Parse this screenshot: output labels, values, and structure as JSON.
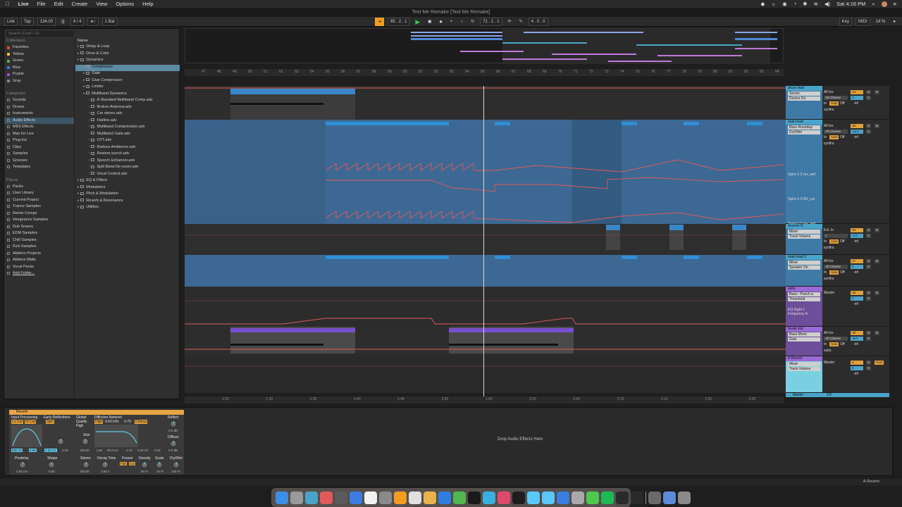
{
  "menubar": {
    "items": [
      "Live",
      "File",
      "Edit",
      "Create",
      "View",
      "Options",
      "Help"
    ],
    "clock": "Sat 4:16 PM"
  },
  "window": {
    "title": "Text Me Remake  [Text Me Remake]"
  },
  "control_bar": {
    "link": "Link",
    "tap": "Tap",
    "tempo": "134.00",
    "signature": "4 / 4",
    "metronome": "●○",
    "quantize": "1 Bar",
    "position": "65 .  2 .  1",
    "loop_start": "71 .  1 .  1",
    "loop_length": "4 .  0 .  0",
    "key": "Key",
    "midi": "MIDI",
    "cpu": "14 %"
  },
  "browser": {
    "search_placeholder": "Search (Cmd + F)",
    "collections_title": "Collections",
    "collections": [
      {
        "label": "Favorites",
        "color": "#e0463a"
      },
      {
        "label": "Yellow",
        "color": "#e9c43a"
      },
      {
        "label": "Green",
        "color": "#4fb84f"
      },
      {
        "label": "Blue",
        "color": "#3a7de0"
      },
      {
        "label": "Purple",
        "color": "#9a4fd8"
      },
      {
        "label": "Gray",
        "color": "#8a8a8a"
      }
    ],
    "categories_title": "Categories",
    "categories": [
      "Sounds",
      "Drums",
      "Instruments",
      "Audio Effects",
      "MIDI Effects",
      "Max for Live",
      "Plug-Ins",
      "Clips",
      "Samples",
      "Grooves",
      "Templates"
    ],
    "selected_category": "Audio Effects",
    "places_title": "Places",
    "places": [
      "Packs",
      "User Library",
      "Current Project",
      "Trance Samples",
      "Remix Comps",
      "Vengeance Samples",
      "Dub Snares",
      "EDM Samples",
      "Chill Samples",
      "Kick Samples",
      "Ableton Projects",
      "Ableton Midis",
      "Vocal Packs",
      "Add Folder..."
    ],
    "name_header": "Name",
    "items": [
      {
        "label": "Delay & Loop",
        "indent": 0
      },
      {
        "label": "Drive & Color",
        "indent": 0
      },
      {
        "label": "Dynamics",
        "indent": 0
      },
      {
        "label": "Compressor",
        "indent": 1,
        "selected": true
      },
      {
        "label": "Gate",
        "indent": 1
      },
      {
        "label": "Glue Compressor",
        "indent": 1
      },
      {
        "label": "Limiter",
        "indent": 1
      },
      {
        "label": "Multiband Dynamics",
        "indent": 1
      },
      {
        "label": "A Standard Multiband Comp.adv",
        "indent": 2
      },
      {
        "label": "Broken Antenna.adv",
        "indent": 2
      },
      {
        "label": "Car stereo.adv",
        "indent": 2
      },
      {
        "label": "Flatline.adv",
        "indent": 2
      },
      {
        "label": "Multiband Compression.adv",
        "indent": 2
      },
      {
        "label": "Multiband Gate.adv",
        "indent": 2
      },
      {
        "label": "OTT.adv",
        "indent": 2
      },
      {
        "label": "Reduce Ambience.adv",
        "indent": 2
      },
      {
        "label": "Restore punch.adv",
        "indent": 2
      },
      {
        "label": "Speech Enhancer.adv",
        "indent": 2
      },
      {
        "label": "Split Band De-esser.adv",
        "indent": 2
      },
      {
        "label": "Vocal Control.adv",
        "indent": 2
      },
      {
        "label": "EQ & Filters",
        "indent": 0
      },
      {
        "label": "Modulators",
        "indent": 0
      },
      {
        "label": "Pitch & Modulation",
        "indent": 0
      },
      {
        "label": "Reverb & Resonance",
        "indent": 0
      },
      {
        "label": "Utilities",
        "indent": 0
      }
    ]
  },
  "beat_ruler": [
    "47",
    "48",
    "49",
    "50",
    "51",
    "52",
    "53",
    "54",
    "55",
    "56",
    "57",
    "58",
    "59",
    "60",
    "61",
    "62",
    "63",
    "64",
    "65",
    "66",
    "67",
    "68",
    "69",
    "70",
    "71",
    "72",
    "73",
    "74",
    "75",
    "76",
    "77",
    "78",
    "79",
    "80",
    "81",
    "82",
    "83",
    "84"
  ],
  "time_ruler": [
    "1:25",
    "1:30",
    "1:35",
    "1:40",
    "1:45",
    "1:50",
    "1:55",
    "2:00",
    "2:05",
    "2:10",
    "2:15",
    "2:20",
    "2:25"
  ],
  "tracks": [
    {
      "name": "arcos lead",
      "device": "Serum",
      "param": "Device On",
      "color": "#4aa4c9",
      "input": "All Ins",
      "channel": "All Channe",
      "num": "14"
    },
    {
      "name": "main lead",
      "device": "Bass Roundup",
      "param": "Dry/Wet",
      "color": "#4aa4c9",
      "input": "All Ins",
      "channel": "All Channe",
      "num": "15",
      "vol": "-11.0"
    },
    {
      "name": "reverse fx",
      "device": "Mixer",
      "param": "Track Volume",
      "color": "#4aa4c9",
      "input": "Ext. In",
      "channel": "1",
      "num": "16",
      "vol": "-4.0"
    },
    {
      "name": "main lead 2",
      "device": "Mixer",
      "param": "Speaker On",
      "color": "#4aa4c9",
      "input": "All Ins",
      "channel": "All Channe",
      "num": "17"
    },
    {
      "name": "subs",
      "device": "Bass - Punch a",
      "param": "Threshold",
      "color": "#9a6ad6",
      "input": "Master",
      "channel": "",
      "num": "18"
    },
    {
      "name": "break sub",
      "device": "Bass Mono",
      "param": "Gain",
      "color": "#9a6ad6",
      "input": "All Ins",
      "channel": "All Channe",
      "num": "19",
      "vol": "-8.0"
    },
    {
      "name": "A Reverb",
      "device": "Mixer",
      "param": "Track Volume",
      "color": "#9a6ad6",
      "input": "Master",
      "channel": "",
      "num": "A",
      "post": "Post"
    }
  ],
  "automation_labels": [
    "Spire-1-3 rev_wet",
    "Spire-1-3 flt1_cut",
    "Spire-1-3 rev_wet",
    "EQ Eight 1 Frequency A"
  ],
  "monitor": {
    "in": "In",
    "auto": "Auto",
    "off": "Off",
    "minf": "-inf",
    "synths": "synths",
    "subs": "subs"
  },
  "master": {
    "label": "Master",
    "fraction": "1/2"
  },
  "device": {
    "title": "Reverb",
    "input_processing": "Input Processing",
    "lo_cut": "Lo Cut",
    "hi_cut": "Hi Cut",
    "early_reflections": "Early Reflections",
    "spin": "Spin",
    "global": "Global",
    "quality": "Quality",
    "quality_val": "High",
    "diffusion": "Diffusion Network",
    "high": "High",
    "high_freq": "4.50 kHz",
    "high_val": "0.70",
    "chorus": "Chorus",
    "reflect": "Reflect",
    "reflect_val": "0.0 dB",
    "diffuse": "Diffuse",
    "diffuse_val": "0.0 dB",
    "size": "Size",
    "size_val": "100.00",
    "freq_lo": "830 Hz",
    "freq_w": "5.85",
    "er1": "0.25 Hz",
    "er2": "3.00",
    "low": "Low",
    "low_freq": "90.0 Hz",
    "low_val": "0.75",
    "d1": "0.02 Hz",
    "d2": "0.02",
    "predelay": "Predelay",
    "predelay_val": "2.50 ms",
    "shape": "Shape",
    "shape_val": "0.50",
    "stereo": "Stereo",
    "stereo_val": "100.00",
    "decay": "Decay Time",
    "decay_val": "2.50 s",
    "freeze": "Freeze",
    "flat": "Flat",
    "cut": "Cut",
    "density": "Density",
    "density_val": "60 %",
    "scale": "Scale",
    "scale_val": "40 %",
    "drywet": "Dry/Wet",
    "drywet_val": "100 %",
    "drop_hint": "Drop Audio Effects Here"
  },
  "status": {
    "text": "A-Reverb"
  },
  "colors": {
    "accent": "#f39c1f",
    "clip_blue": "#3d6893",
    "clip_purple": "#7a4fd0",
    "automation": "#e05a5a"
  }
}
